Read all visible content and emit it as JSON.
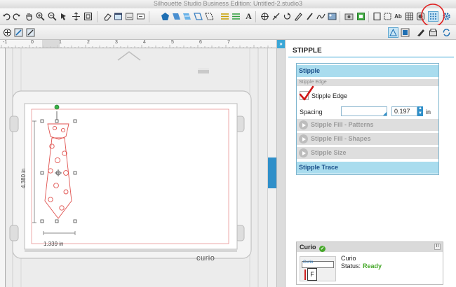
{
  "window": {
    "title": "Silhouette Studio Business Edition: Untitled-2.studio3"
  },
  "ruler": {
    "ticks": [
      "-1",
      "0",
      "1",
      "2",
      "3",
      "4",
      "5",
      "6",
      "7"
    ]
  },
  "canvas": {
    "height_dim": "4.380 in",
    "width_dim": "1.339 in",
    "mat_brand": "curio"
  },
  "panel": {
    "title": "STIPPLE",
    "stipple_header": "Stipple",
    "subheading": "Stipple Edge",
    "edge_checkbox_label": "Stipple Edge",
    "spacing_label": "Spacing",
    "spacing_value": "0.197",
    "spacing_unit": "in",
    "sections": [
      "Stipple Fill - Patterns",
      "Stipple Fill - Shapes",
      "Stipple Size"
    ],
    "trace_header": "Stipple Trace"
  },
  "curio": {
    "header": "Curio",
    "device_name": "Curio",
    "status_label": "Status:",
    "status_value": "Ready",
    "thumb_label": "Curio",
    "thumb_glyph": "F"
  },
  "colors": {
    "accent": "#3aa6d6",
    "status_ready": "#46a82a",
    "cut_line": "#e0524f",
    "annotation_circle": "#e02020"
  }
}
